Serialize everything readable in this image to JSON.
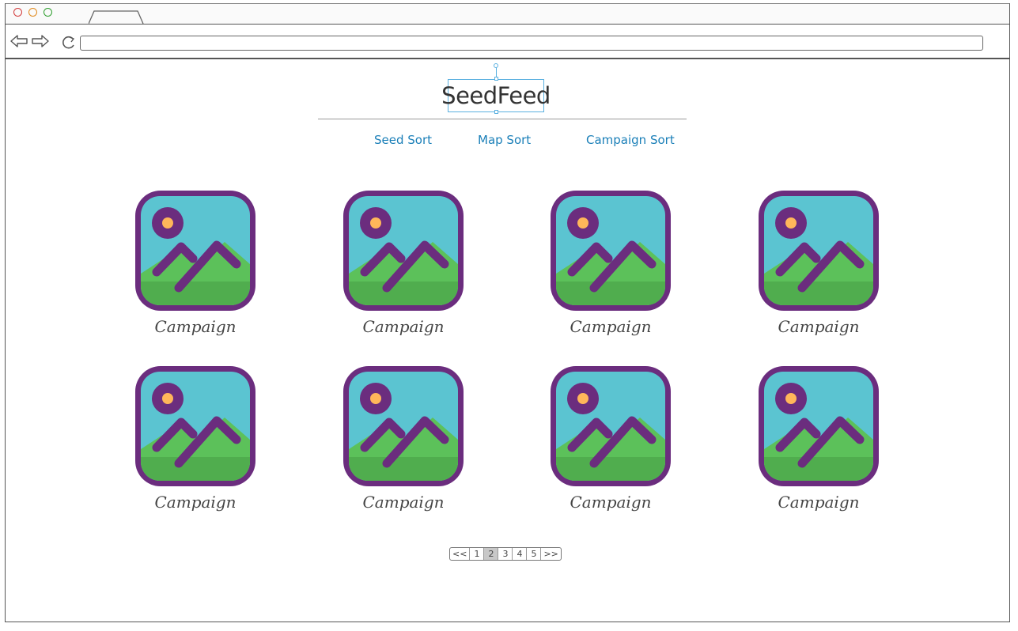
{
  "app": {
    "logo_text": "SeedFeed"
  },
  "nav": {
    "links": [
      {
        "label": "Seed Sort"
      },
      {
        "label": "Map Sort"
      },
      {
        "label": "Campaign Sort"
      }
    ]
  },
  "campaigns": [
    {
      "label": "Campaign"
    },
    {
      "label": "Campaign"
    },
    {
      "label": "Campaign"
    },
    {
      "label": "Campaign"
    },
    {
      "label": "Campaign"
    },
    {
      "label": "Campaign"
    },
    {
      "label": "Campaign"
    },
    {
      "label": "Campaign"
    }
  ],
  "pagination": {
    "first": "<<",
    "pages": [
      "1",
      "2",
      "3",
      "4",
      "5"
    ],
    "last": ">>",
    "current_page": "2"
  },
  "colors": {
    "frame": "#6b2d7e",
    "sky": "#5bc4d1",
    "grass": "#5cc15a",
    "grass_dark": "#50ad4e",
    "sun": "#ffb65a",
    "link": "#1a7fb8",
    "selection": "#5ab0e0"
  },
  "icons": {
    "back": "back-arrow-icon",
    "forward": "forward-arrow-icon",
    "reload": "reload-icon",
    "image_placeholder": "image-placeholder-icon"
  }
}
